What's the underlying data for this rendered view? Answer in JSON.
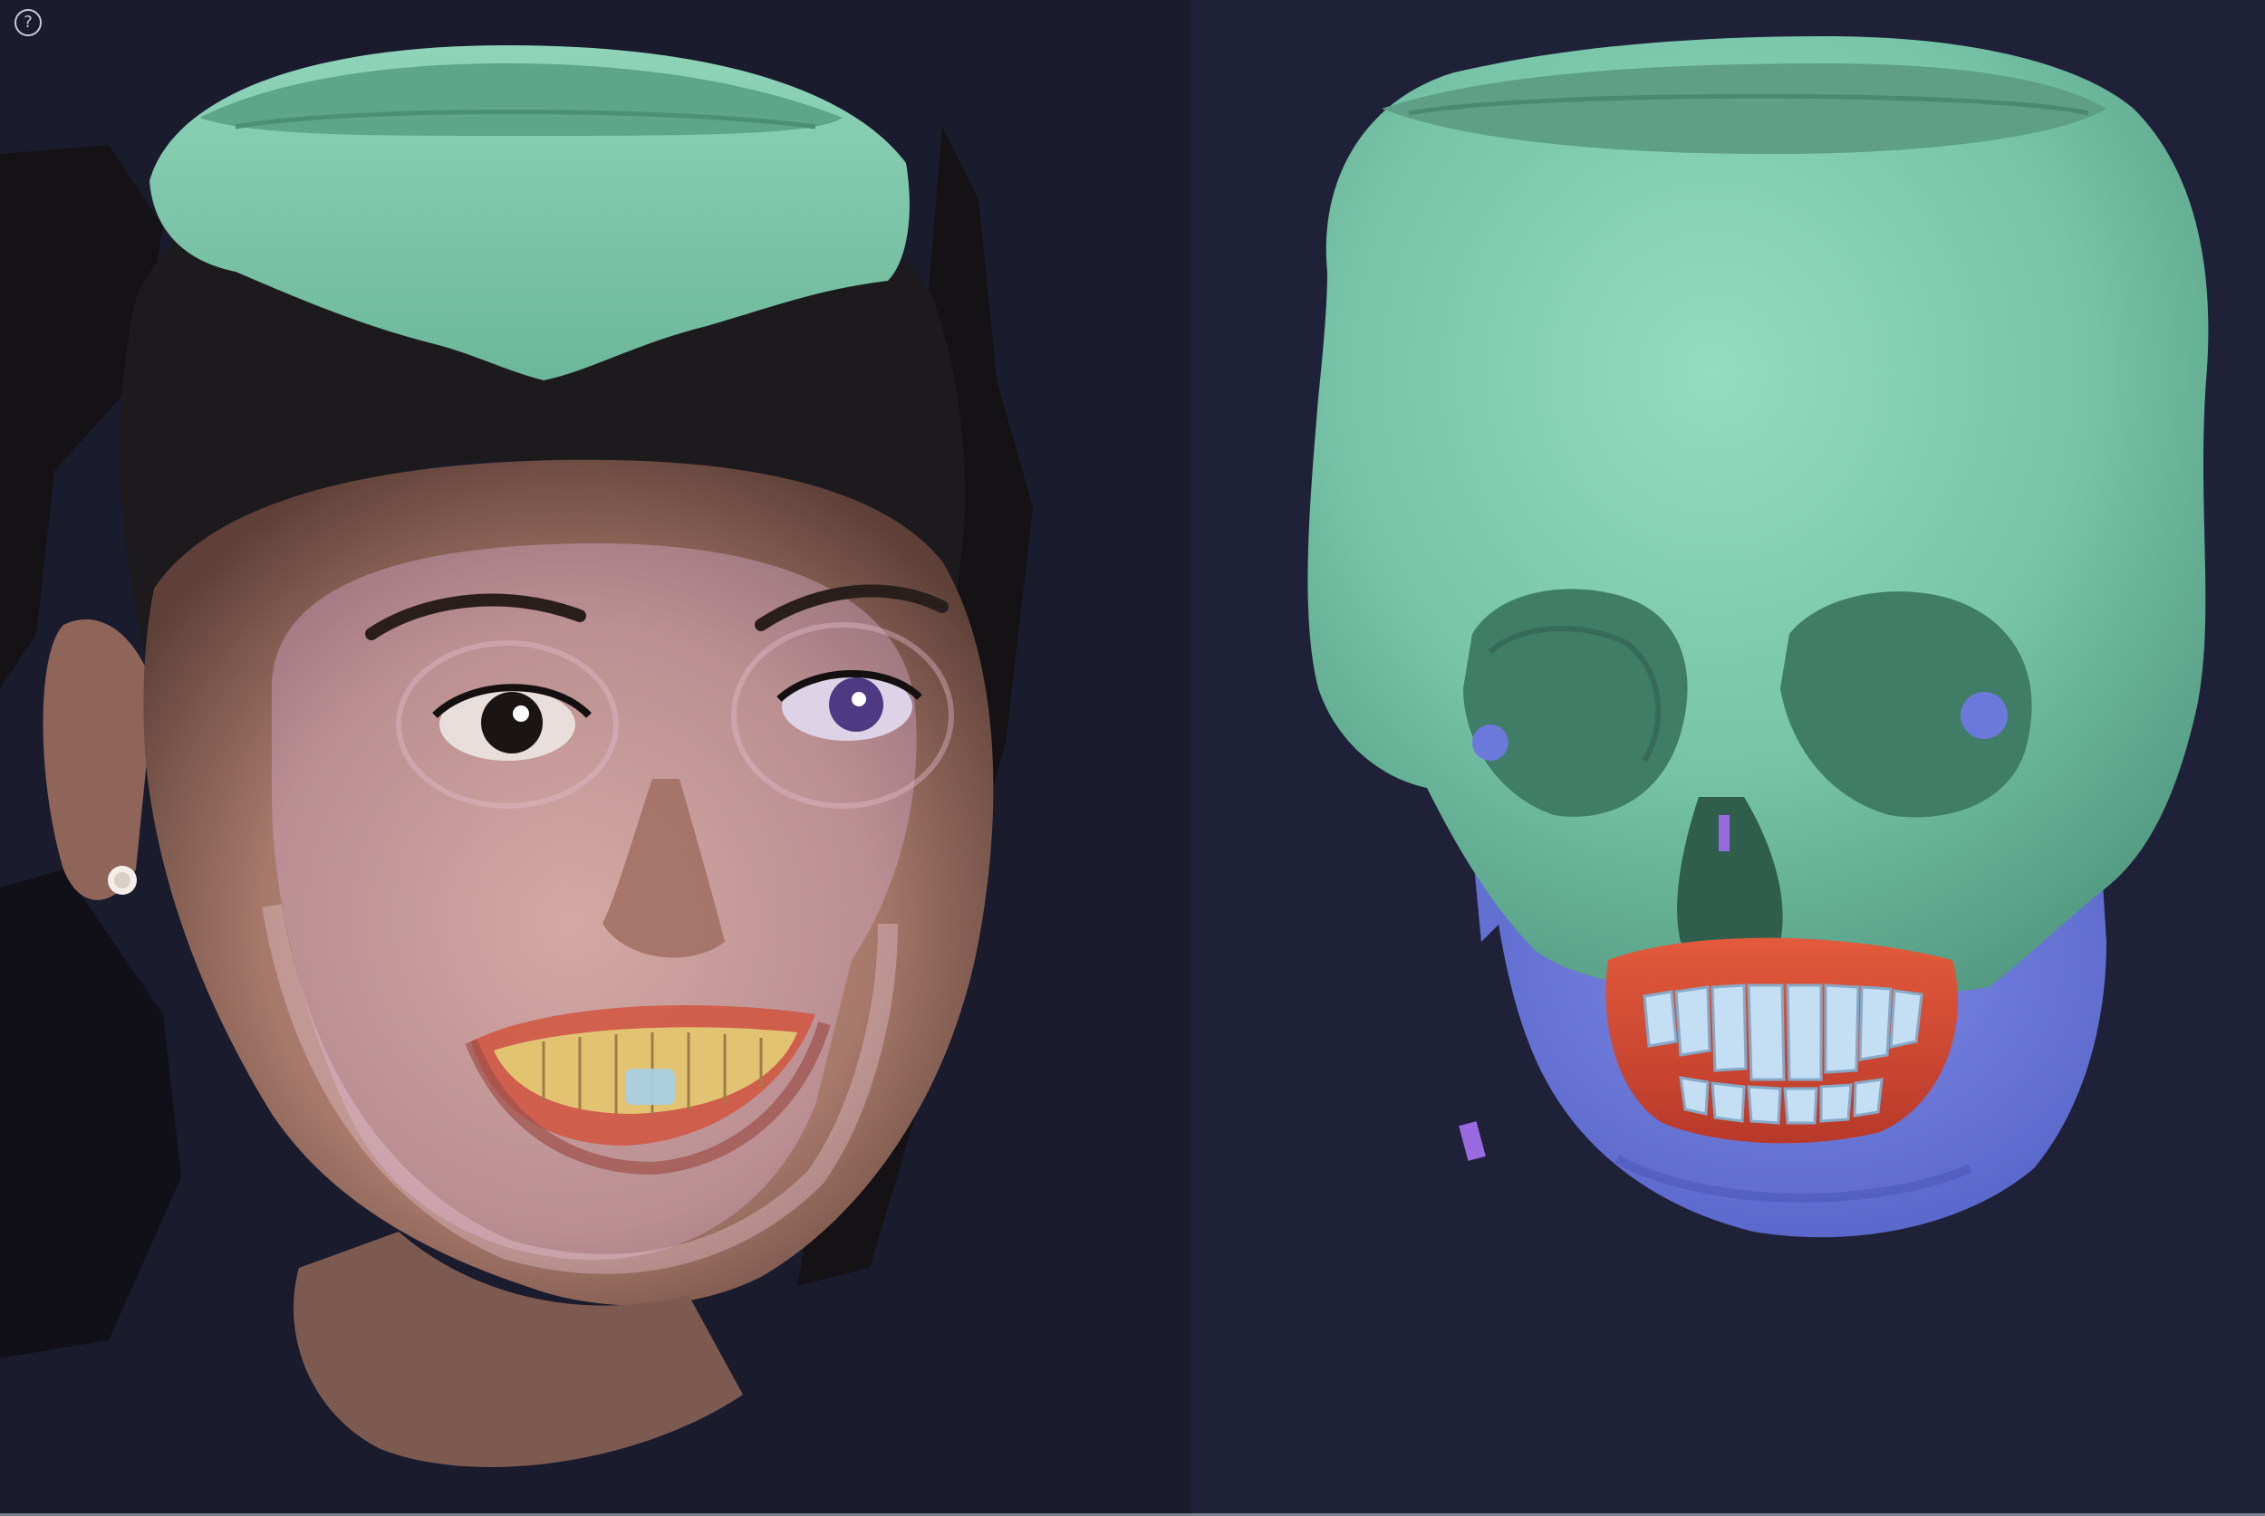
{
  "toolbar": {
    "help_glyph": "?"
  },
  "views": [
    {
      "name": "face-scan-overlay-view",
      "layers": [
        "face-scan",
        "skull",
        "mandible",
        "teeth"
      ]
    },
    {
      "name": "skull-model-view",
      "layers": [
        "skull",
        "mandible",
        "teeth",
        "gums"
      ]
    }
  ],
  "colors": {
    "skull": "#76c4a8",
    "mandible": "#6a78d6",
    "teeth": "#bcd8f0",
    "gums": "#d8452c",
    "skin": "#b58a78",
    "hair": "#1a1618",
    "background_left": "#1a1b2d",
    "background_right": "#1f2138"
  }
}
